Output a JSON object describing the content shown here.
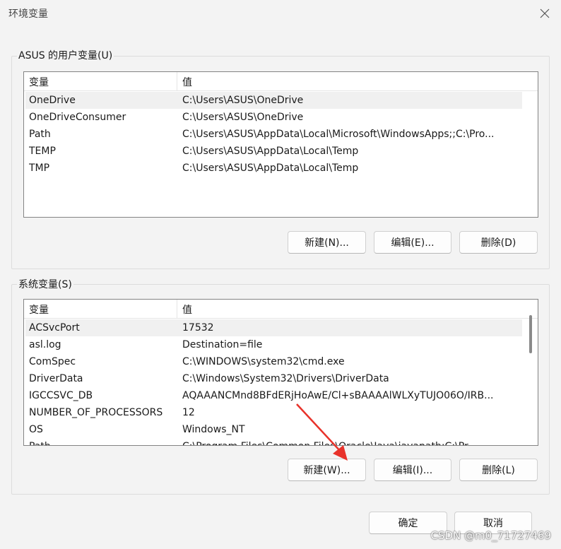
{
  "window": {
    "title": "环境变量",
    "close_icon": "close-icon"
  },
  "user_vars": {
    "group_label": "ASUS 的用户变量(U)",
    "columns": [
      "变量",
      "值"
    ],
    "rows": [
      {
        "name": "OneDrive",
        "value": "C:\\Users\\ASUS\\OneDrive"
      },
      {
        "name": "OneDriveConsumer",
        "value": "C:\\Users\\ASUS\\OneDrive"
      },
      {
        "name": "Path",
        "value": "C:\\Users\\ASUS\\AppData\\Local\\Microsoft\\WindowsApps;;C:\\Pro..."
      },
      {
        "name": "TEMP",
        "value": "C:\\Users\\ASUS\\AppData\\Local\\Temp"
      },
      {
        "name": "TMP",
        "value": "C:\\Users\\ASUS\\AppData\\Local\\Temp"
      }
    ],
    "buttons": {
      "new": "新建(N)...",
      "edit": "编辑(E)...",
      "delete": "删除(D)"
    }
  },
  "system_vars": {
    "group_label": "系统变量(S)",
    "columns": [
      "变量",
      "值"
    ],
    "rows": [
      {
        "name": "ACSvcPort",
        "value": "17532"
      },
      {
        "name": "asl.log",
        "value": "Destination=file"
      },
      {
        "name": "ComSpec",
        "value": "C:\\WINDOWS\\system32\\cmd.exe"
      },
      {
        "name": "DriverData",
        "value": "C:\\Windows\\System32\\Drivers\\DriverData"
      },
      {
        "name": "IGCCSVC_DB",
        "value": "AQAAANCMnd8BFdERjHoAwE/Cl+sBAAAAlWLXyTUJO06O/IRB..."
      },
      {
        "name": "NUMBER_OF_PROCESSORS",
        "value": "12"
      },
      {
        "name": "OS",
        "value": "Windows_NT"
      },
      {
        "name": "Path",
        "value": "C:\\Program Files\\Common Files\\Oracle\\Java\\javapath;C:\\Pr..."
      }
    ],
    "buttons": {
      "new": "新建(W)...",
      "edit": "编辑(I)...",
      "delete": "删除(L)"
    }
  },
  "footer": {
    "ok": "确定",
    "cancel": "取消"
  },
  "watermark": "CSDN @m0_71727469",
  "colors": {
    "background": "#f3f3f3",
    "selected_row": "#f0f0f0",
    "arrow": "#e8322a"
  }
}
